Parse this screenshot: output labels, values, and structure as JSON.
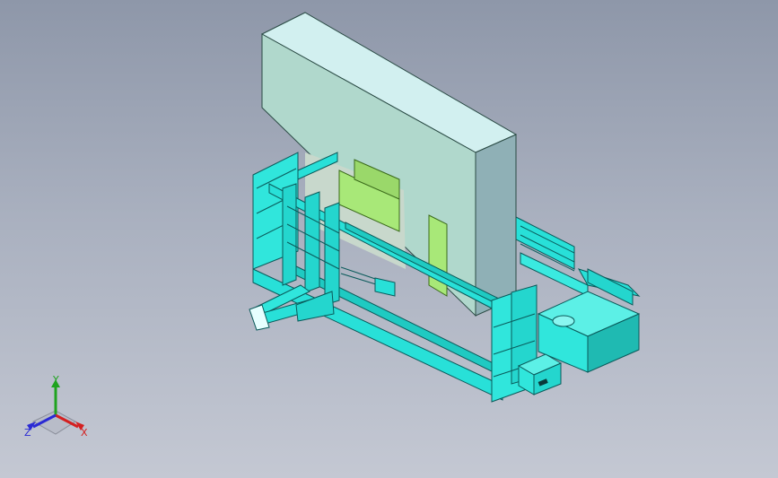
{
  "viewport": {
    "background_top": "#8e97a9",
    "background_bottom": "#c4c8d3",
    "model": {
      "press_body_color": "#b0d8cc",
      "press_edge_color": "#2a4a44",
      "frame_color": "#28e0d8",
      "frame_edge_color": "#0a5a5a",
      "panel_color": "#30e6dc",
      "die_color": "#a8e878",
      "box_color": "#30e8dc",
      "dark_line_color": "#1a2a2e"
    }
  },
  "triad": {
    "x_label": "X",
    "y_label": "Y",
    "z_label": "Z",
    "x_color": "#d42020",
    "y_color": "#1fa31f",
    "z_color": "#2a2ad4"
  }
}
